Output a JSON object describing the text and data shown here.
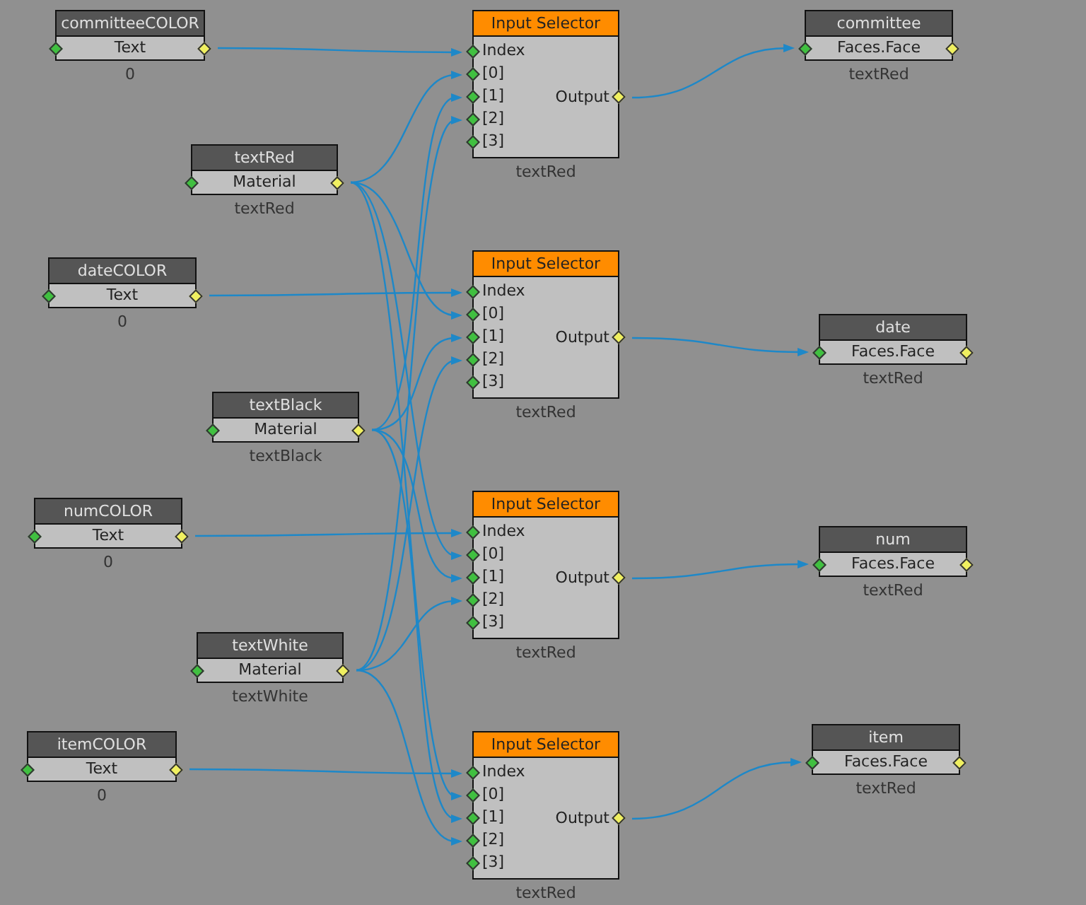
{
  "nodes": [
    {
      "kind": "value",
      "title": "committeeCOLOR",
      "port": "Text",
      "caption": "0"
    },
    {
      "kind": "selector",
      "title": "Input Selector",
      "inputs": [
        "Index",
        "[0]",
        "[1]",
        "[2]",
        "[3]"
      ],
      "output": "Output",
      "caption": "textRed"
    },
    {
      "kind": "face",
      "title": "committee",
      "port": "Faces.Face",
      "caption": "textRed"
    },
    {
      "kind": "value",
      "title": "textRed",
      "port": "Material",
      "caption": "textRed"
    },
    {
      "kind": "value",
      "title": "dateCOLOR",
      "port": "Text",
      "caption": "0"
    },
    {
      "kind": "selector",
      "title": "Input Selector",
      "inputs": [
        "Index",
        "[0]",
        "[1]",
        "[2]",
        "[3]"
      ],
      "output": "Output",
      "caption": "textRed"
    },
    {
      "kind": "face",
      "title": "date",
      "port": "Faces.Face",
      "caption": "textRed"
    },
    {
      "kind": "value",
      "title": "textBlack",
      "port": "Material",
      "caption": "textBlack"
    },
    {
      "kind": "value",
      "title": "numCOLOR",
      "port": "Text",
      "caption": "0"
    },
    {
      "kind": "selector",
      "title": "Input Selector",
      "inputs": [
        "Index",
        "[0]",
        "[1]",
        "[2]",
        "[3]"
      ],
      "output": "Output",
      "caption": "textRed"
    },
    {
      "kind": "face",
      "title": "num",
      "port": "Faces.Face",
      "caption": "textRed"
    },
    {
      "kind": "value",
      "title": "textWhite",
      "port": "Material",
      "caption": "textWhite"
    },
    {
      "kind": "value",
      "title": "itemCOLOR",
      "port": "Text",
      "caption": "0"
    },
    {
      "kind": "selector",
      "title": "Input Selector",
      "inputs": [
        "Index",
        "[0]",
        "[1]",
        "[2]",
        "[3]"
      ],
      "output": "Output",
      "caption": "textRed"
    },
    {
      "kind": "face",
      "title": "item",
      "port": "Faces.Face",
      "caption": "textRed"
    }
  ]
}
